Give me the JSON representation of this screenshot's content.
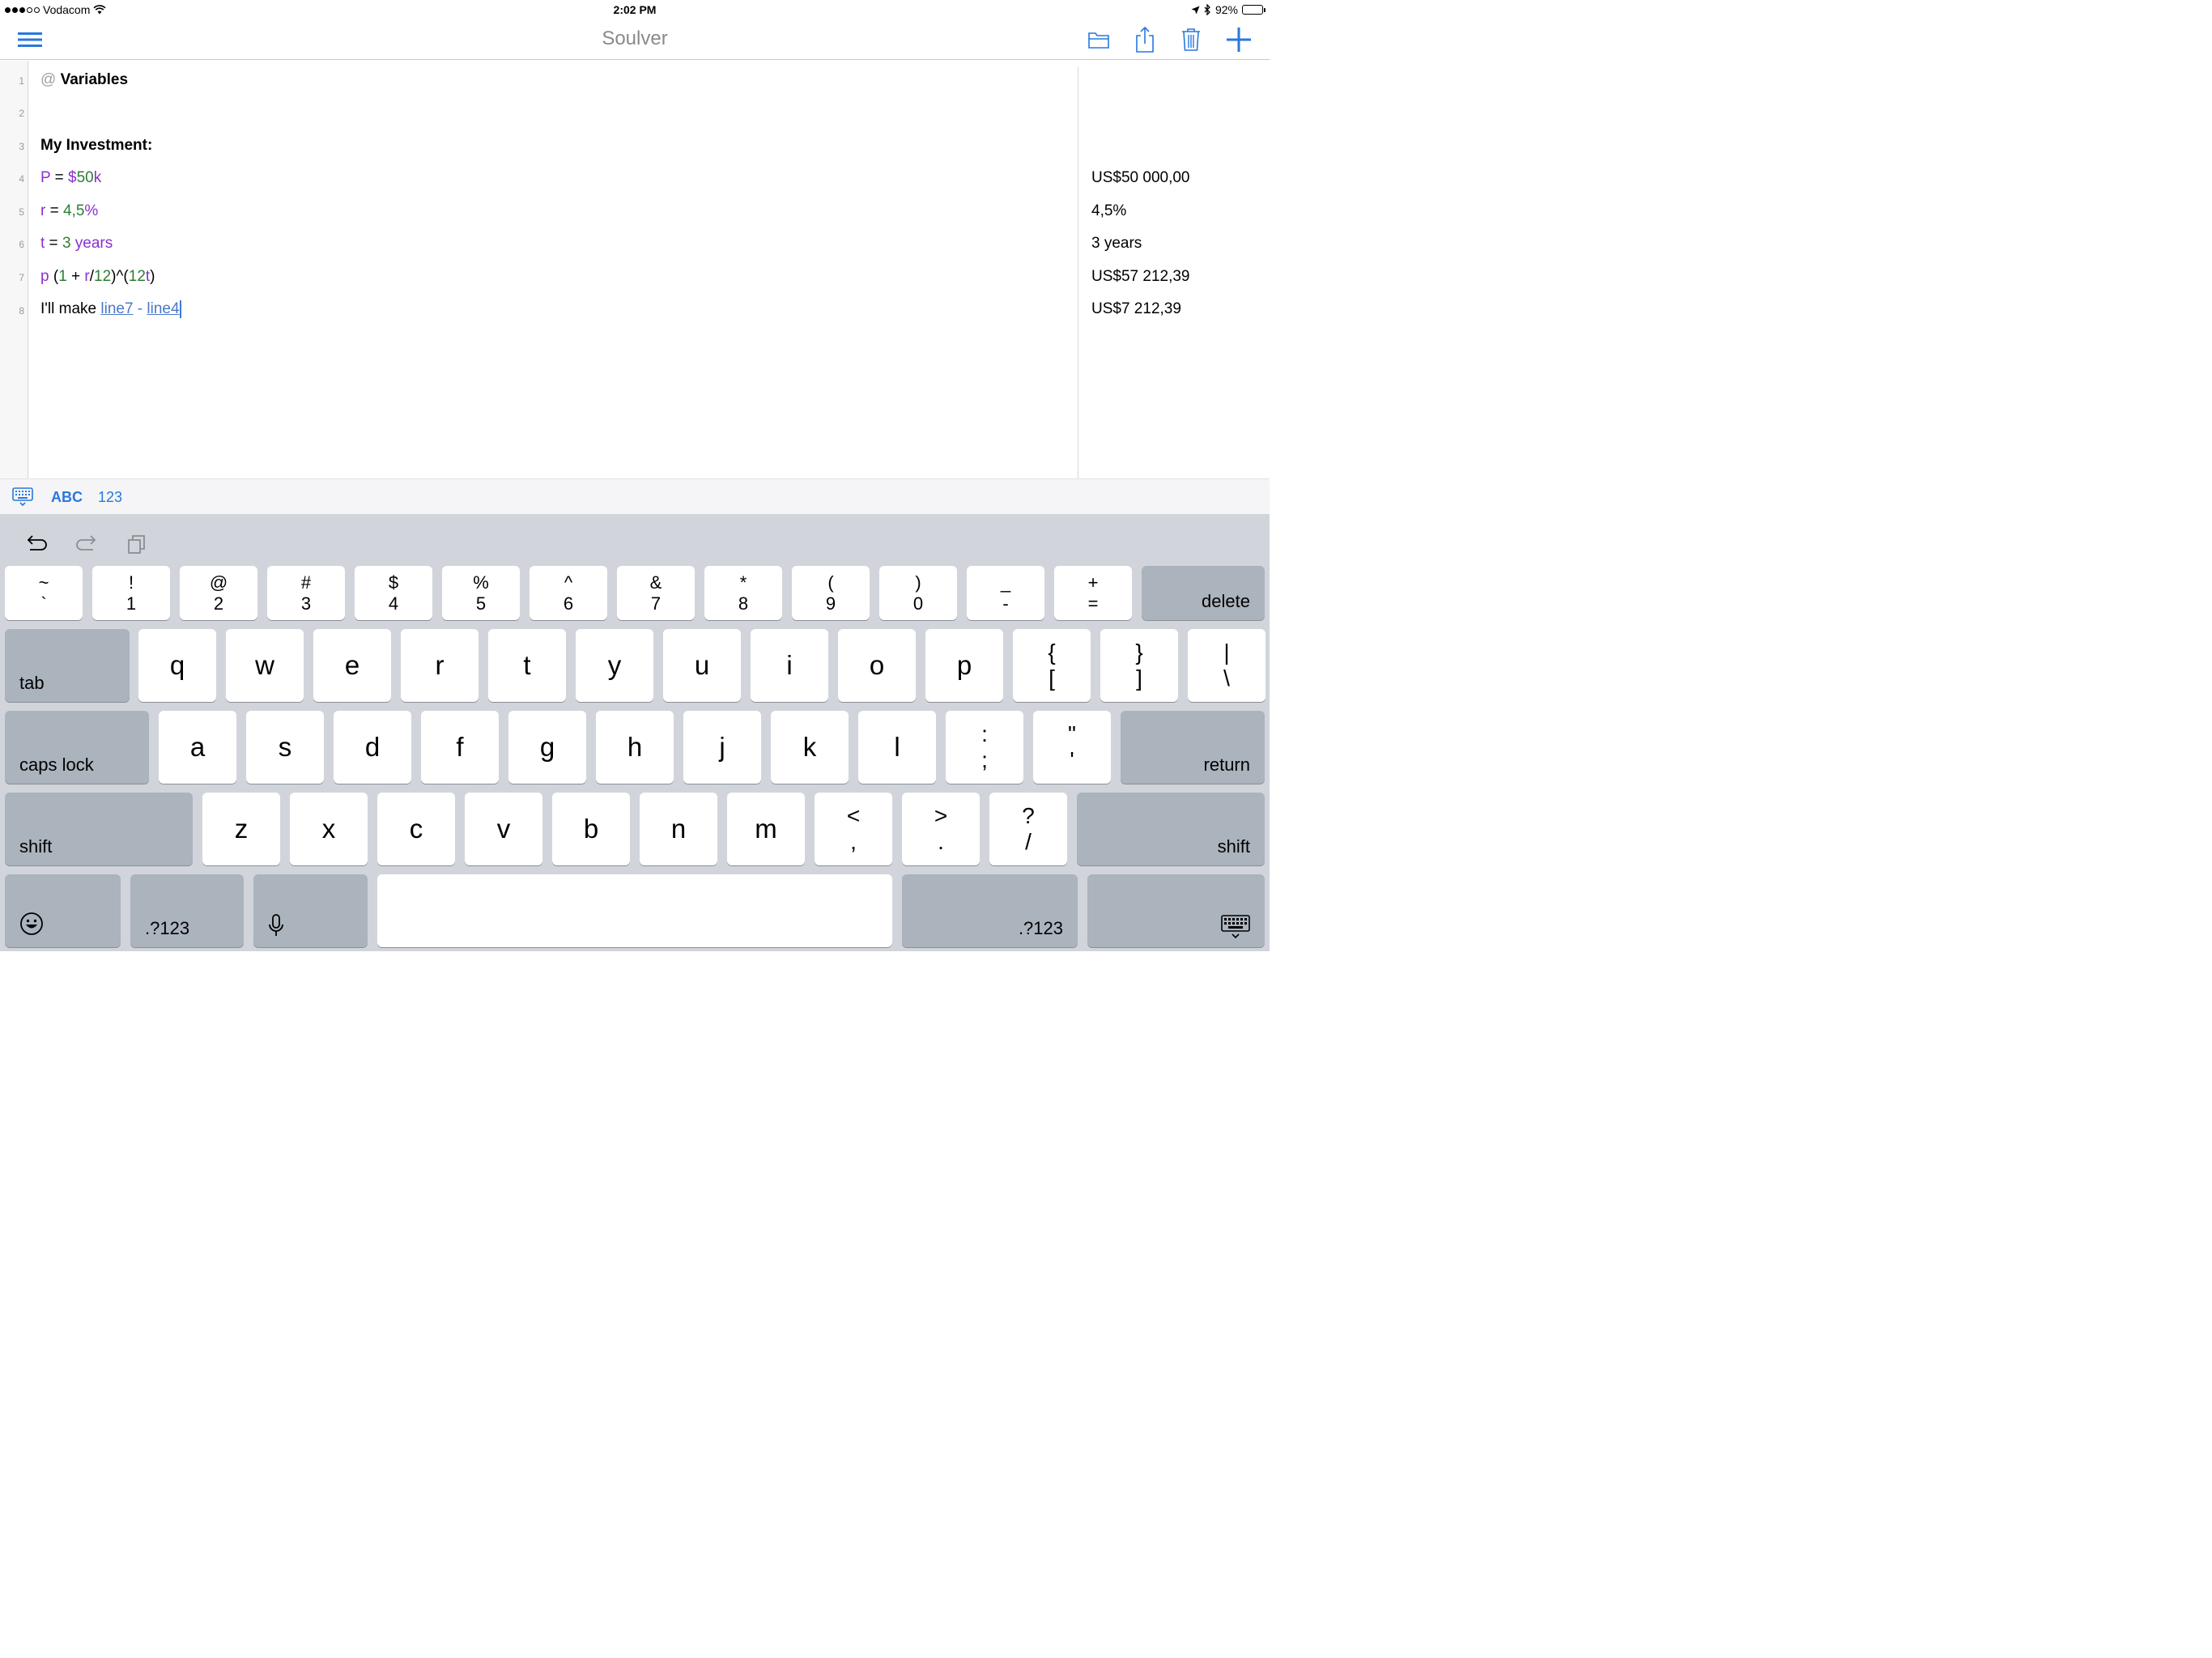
{
  "status_bar": {
    "carrier": "Vodacom",
    "time": "2:02 PM",
    "battery": "92%",
    "battery_level": 0.92
  },
  "nav": {
    "title": "Soulver",
    "icons": [
      "hamburger-menu-icon",
      "folder-icon",
      "share-icon",
      "trash-icon",
      "plus-icon"
    ]
  },
  "editor": {
    "line_numbers": [
      "1",
      "2",
      "3",
      "4",
      "5",
      "6",
      "7",
      "8"
    ],
    "l1": {
      "at": "@",
      "text": "Variables"
    },
    "l3": {
      "text": "My Investment:"
    },
    "l4": {
      "var": "P",
      "eq": " = ",
      "num": "$50",
      "unit": "k"
    },
    "l5": {
      "var": "r",
      "eq": " = ",
      "num": "4,5",
      "unit": "%"
    },
    "l6": {
      "var": "t",
      "eq": " = ",
      "num": "3",
      "unit": "years"
    },
    "l7": {
      "p": "p",
      "open": " (",
      "one": "1",
      "plus": " + ",
      "r": "r",
      "div": "/",
      "twelve": "12",
      "close": ")^(",
      "twelve2": "12",
      "t": "t",
      "end": ")"
    },
    "l8": {
      "text": "I'll make ",
      "ref1": "line7",
      "minus": " - ",
      "ref2": "line4"
    },
    "results": {
      "r4": "US$50 000,00",
      "r5": "4,5%",
      "r6": "3 years",
      "r7": "US$57 212,39",
      "r8": "US$7 212,39"
    }
  },
  "accessory": {
    "abc": "ABC",
    "num": "123"
  },
  "keyboard": {
    "row1": [
      {
        "top": "~",
        "bottom": "`"
      },
      {
        "top": "!",
        "bottom": "1"
      },
      {
        "top": "@",
        "bottom": "2"
      },
      {
        "top": "#",
        "bottom": "3"
      },
      {
        "top": "$",
        "bottom": "4"
      },
      {
        "top": "%",
        "bottom": "5"
      },
      {
        "top": "^",
        "bottom": "6"
      },
      {
        "top": "&",
        "bottom": "7"
      },
      {
        "top": "*",
        "bottom": "8"
      },
      {
        "top": "(",
        "bottom": "9"
      },
      {
        "top": ")",
        "bottom": "0"
      },
      {
        "top": "_",
        "bottom": "-"
      },
      {
        "top": "+",
        "bottom": "="
      }
    ],
    "delete": "delete",
    "tab": "tab",
    "row2": [
      "q",
      "w",
      "e",
      "r",
      "t",
      "y",
      "u",
      "i",
      "o",
      "p"
    ],
    "row2_sym": [
      {
        "top": "{",
        "bottom": "["
      },
      {
        "top": "}",
        "bottom": "]"
      },
      {
        "top": "|",
        "bottom": "\\"
      }
    ],
    "caps": "caps lock",
    "row3": [
      "a",
      "s",
      "d",
      "f",
      "g",
      "h",
      "j",
      "k",
      "l"
    ],
    "row3_sym": [
      {
        "top": ":",
        "bottom": ";"
      },
      {
        "top": "\"",
        "bottom": "'"
      }
    ],
    "return": "return",
    "shift": "shift",
    "row4": [
      "z",
      "x",
      "c",
      "v",
      "b",
      "n",
      "m"
    ],
    "row4_sym": [
      {
        "top": "<",
        "bottom": ","
      },
      {
        "top": ">",
        "bottom": "."
      },
      {
        "top": "?",
        "bottom": "/"
      }
    ],
    "num_switch": ".?123"
  }
}
